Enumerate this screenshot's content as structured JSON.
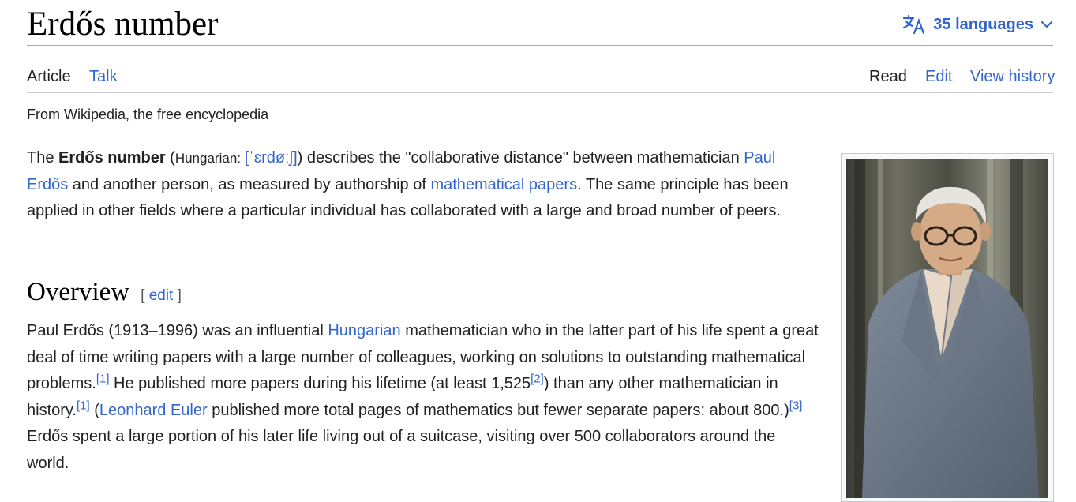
{
  "page": {
    "title": "Erdős number"
  },
  "languages": {
    "label": "35 languages"
  },
  "tabs": {
    "article": "Article",
    "talk": "Talk",
    "read": "Read",
    "edit": "Edit",
    "history": "View history"
  },
  "tagline": "From Wikipedia, the free encyclopedia",
  "intro": {
    "t1": "The ",
    "bold": "Erdős number",
    "t2": " (",
    "lang_label": "Hungarian: ",
    "ipa": "[ˈɛrdøːʃ]",
    "t3": ") describes the \"collaborative distance\" between mathematician ",
    "link1": "Paul Erdős",
    "t4": " and another person, as measured by authorship of ",
    "link2": "mathematical papers",
    "t5": ". The same principle has been applied in other fields where a particular individual has collaborated with a large and broad number of peers."
  },
  "overview": {
    "heading": "Overview",
    "edit_open": "[ ",
    "edit_label": "edit",
    "edit_close": " ]",
    "t1": "Paul Erdős (1913–1996) was an influential ",
    "link1": "Hungarian",
    "t2": " mathematician who in the latter part of his life spent a great deal of time writing papers with a large number of colleagues, working on solutions to outstanding mathematical problems.",
    "ref1": "[1]",
    "t3": " He published more papers during his lifetime (at least 1,525",
    "ref2": "[2]",
    "t4": ") than any other mathematician in history.",
    "ref3": "[1]",
    "t5": " (",
    "link2": "Leonhard Euler",
    "t6": " published more total pages of mathematics but fewer separate papers: about 800.)",
    "ref4": "[3]",
    "t7": " Erdős spent a large portion of his later life living out of a suitcase, visiting over 500 collaborators around the world."
  },
  "icons": {
    "language": "translate-icon",
    "chevron": "chevron-down-icon"
  },
  "colors": {
    "link": "#3366cc",
    "text": "#202122",
    "rule": "#a2a9b1"
  }
}
